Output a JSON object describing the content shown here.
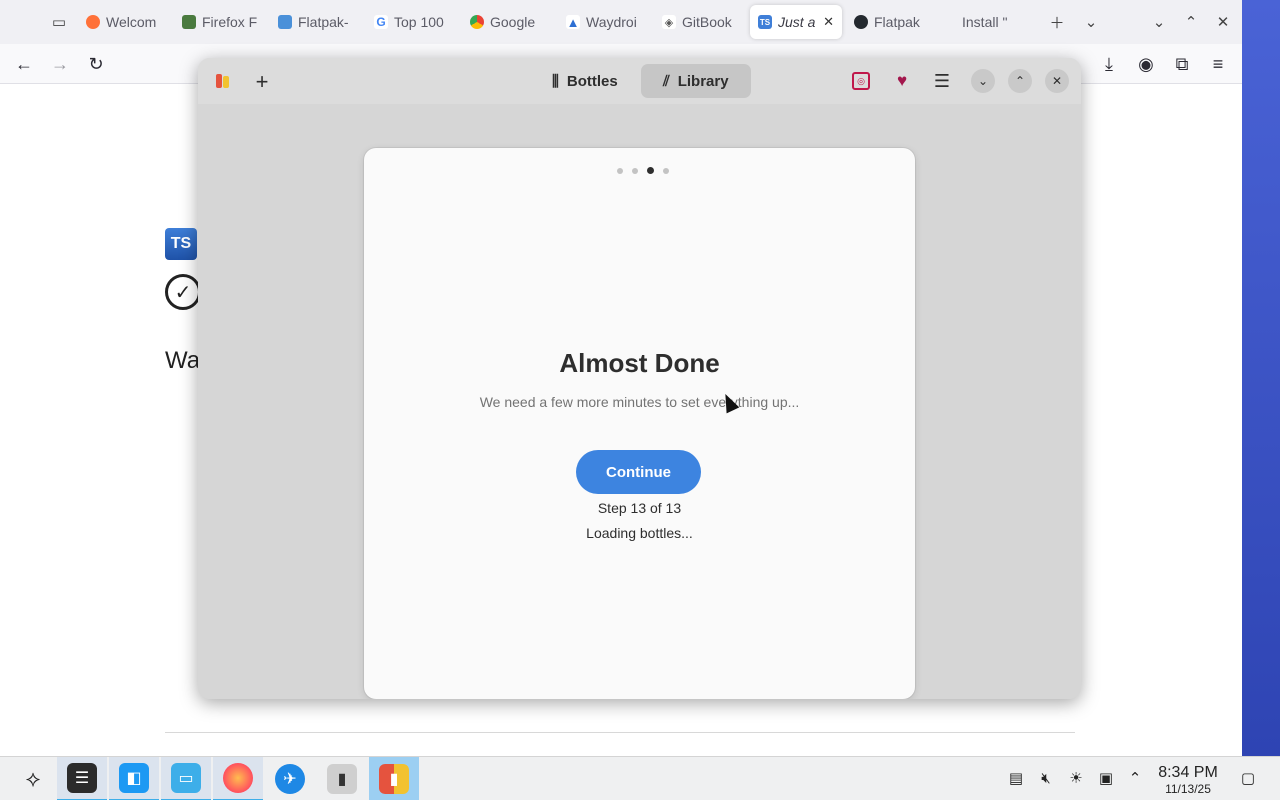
{
  "browser": {
    "tabs": [
      {
        "title": "Welcom",
        "favicon": "firefox-icon",
        "color": "#ff7139"
      },
      {
        "title": "Firefox F",
        "favicon": "page-icon",
        "color": "#4a7a3f"
      },
      {
        "title": "Flatpak-",
        "favicon": "flatpak-icon",
        "color": "#4a90d9"
      },
      {
        "title": "Top 100",
        "favicon": "google-g-icon",
        "color": "#4285f4"
      },
      {
        "title": "Google",
        "favicon": "chrome-icon",
        "color": "#34a853"
      },
      {
        "title": "Waydroi",
        "favicon": "waydroid-icon",
        "color": "#2d6fd3"
      },
      {
        "title": "GitBook",
        "favicon": "gitbook-icon",
        "color": "#555555"
      },
      {
        "title": "Just a",
        "favicon": "ts-icon",
        "color": "#3f7fd8",
        "active": true
      },
      {
        "title": "Flatpak",
        "favicon": "github-icon",
        "color": "#24292f"
      },
      {
        "title": "Install \"",
        "favicon": "none",
        "color": "#f0f0f4"
      }
    ],
    "page": {
      "logo_text": "TS",
      "heading": "Wa"
    }
  },
  "bottles": {
    "view_switcher": {
      "bottles_label": "Bottles",
      "library_label": "Library"
    },
    "onboarding": {
      "title": "Almost Done",
      "subtitle": "We need a few more minutes to set everything up...",
      "continue_label": "Continue",
      "step_label": "Step 13 of 13",
      "status_label": "Loading bottles...",
      "page_count": 4,
      "current_page": 3
    },
    "accent_color": "#3d84e0"
  },
  "taskbar": {
    "clock_time": "8:34 PM",
    "clock_date": "11/13/25"
  }
}
